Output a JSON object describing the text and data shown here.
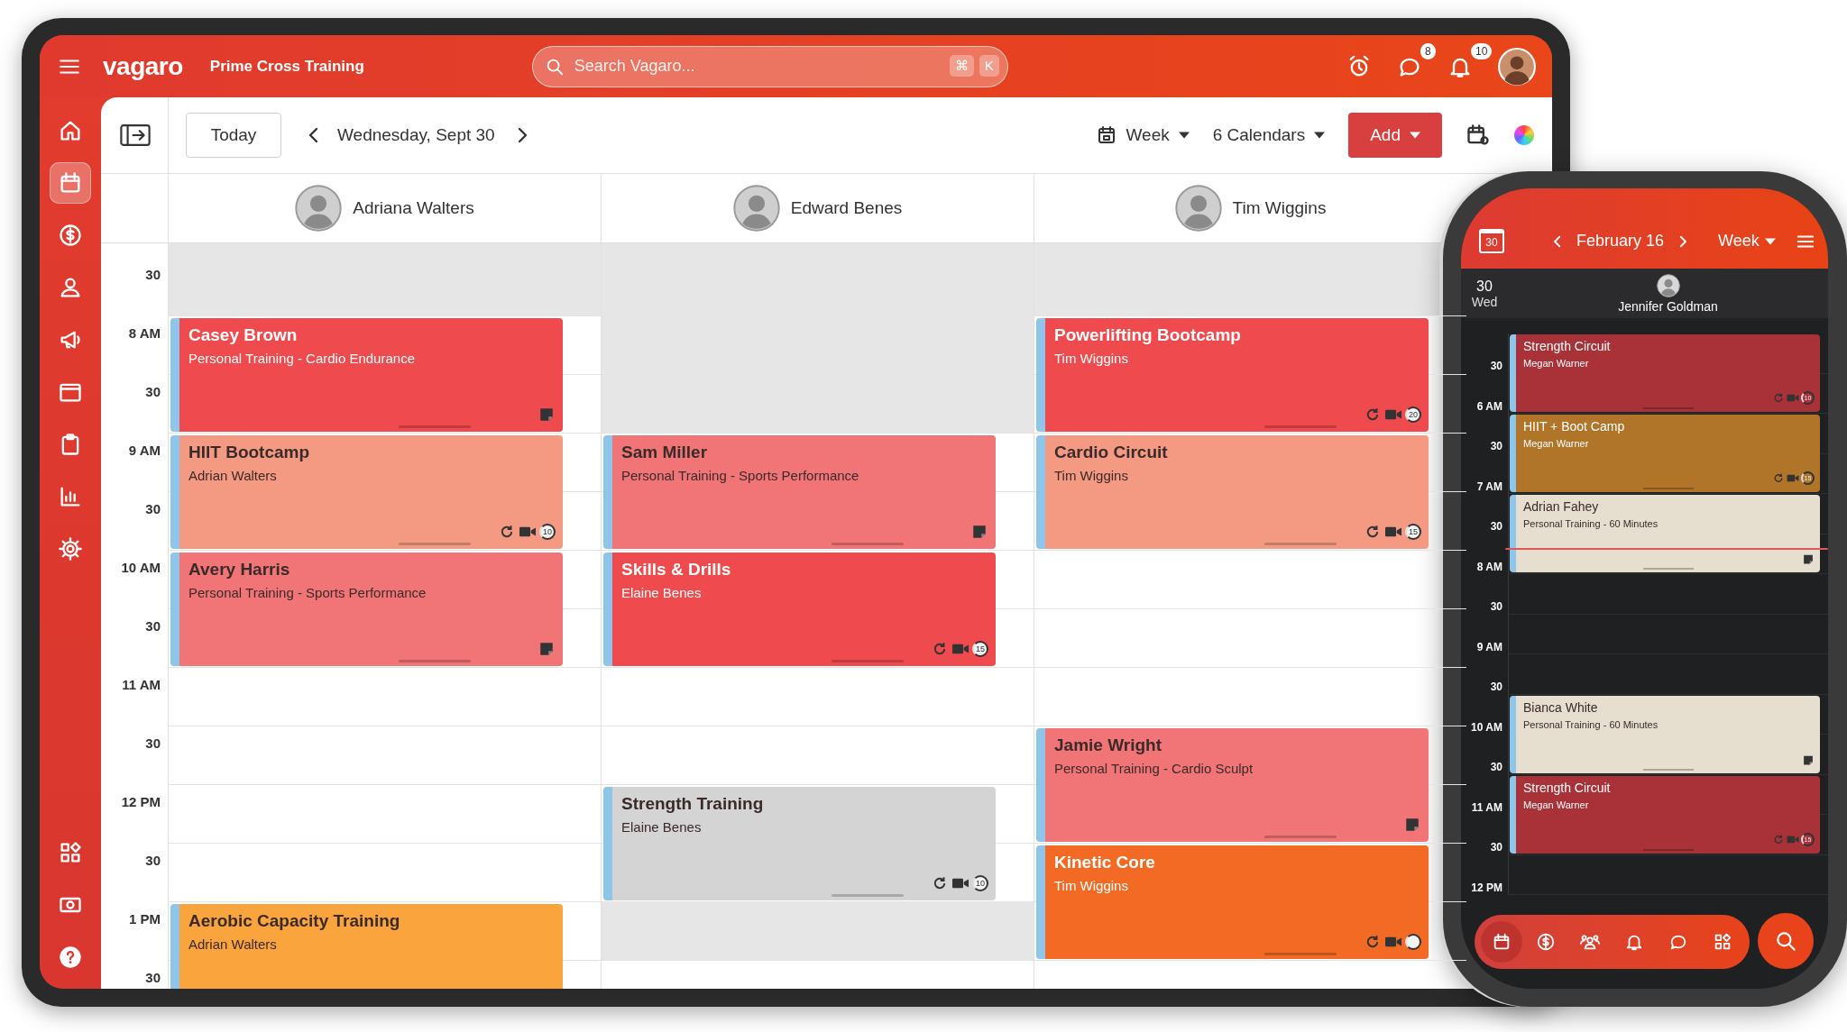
{
  "topbar": {
    "logo": "vagaro",
    "business": "Prime Cross Training",
    "search": {
      "placeholder": "Search Vagaro...",
      "shortcut_keys": [
        "⌘",
        "K"
      ]
    },
    "chat_badge": "8",
    "notification_badge": "10"
  },
  "sidebar": {
    "items": [
      {
        "kind": "home",
        "selected": false
      },
      {
        "kind": "calendar",
        "selected": true
      },
      {
        "kind": "dollar",
        "selected": false
      },
      {
        "kind": "person",
        "selected": false
      },
      {
        "kind": "megaphone",
        "selected": false
      },
      {
        "kind": "window",
        "selected": false
      },
      {
        "kind": "clipboard",
        "selected": false
      },
      {
        "kind": "chart",
        "selected": false
      },
      {
        "kind": "gear",
        "selected": false
      }
    ],
    "bottom_items": [
      {
        "kind": "apps",
        "selected": false
      },
      {
        "kind": "cash",
        "selected": false
      },
      {
        "kind": "help",
        "selected": false
      }
    ]
  },
  "toolbar": {
    "today": "Today",
    "date": "Wednesday, Sept 30",
    "view": "Week",
    "calendars": "6 Calendars",
    "add": "Add"
  },
  "time_labels": [
    "30",
    "8 AM",
    "30",
    "9 AM",
    "30",
    "10 AM",
    "30",
    "11 AM",
    "30",
    "12 PM",
    "30",
    "1 PM",
    "30"
  ],
  "staff": [
    {
      "name": "Adriana Walters",
      "slots": [
        {
          "kind": "unavailable"
        },
        {
          "kind": "appointment",
          "title": "Casey Brown",
          "subtitle": "Personal Training - Cardio Endurance",
          "color": "#ef4a4d"
        },
        {
          "kind": "class",
          "title": "HIIT Bootcamp",
          "subtitle": "Adrian Walters",
          "color": "#f59a82",
          "timer": "10"
        },
        {
          "kind": "appointment",
          "title": "Avery Harris",
          "subtitle": "Personal Training - Sports Performance",
          "color": "#f17577"
        },
        {
          "kind": "free"
        },
        {
          "kind": "free"
        },
        {
          "kind": "free"
        },
        {
          "kind": "free"
        },
        {
          "kind": "class",
          "title": "Aerobic Capacity Training",
          "subtitle": "Adrian Walters",
          "color": "#f9a43c"
        }
      ]
    },
    {
      "name": "Edward Benes",
      "slots": [
        {
          "kind": "unavailable"
        },
        {
          "kind": "unavailable"
        },
        {
          "kind": "unavailable"
        },
        {
          "kind": "appointment",
          "title": "Sam Miller",
          "subtitle": "Personal Training - Sports Performance",
          "color": "#f17577"
        },
        {
          "kind": "class",
          "title": "Skills & Drills",
          "subtitle": "Elaine Benes",
          "color": "#ef4a4d",
          "timer": "15"
        },
        {
          "kind": "free"
        },
        {
          "kind": "free"
        },
        {
          "kind": "class",
          "title": "Strength Training",
          "subtitle": "Elaine Benes",
          "color": "#d4d4d4",
          "timer": "10"
        },
        {
          "kind": "unavailable"
        }
      ]
    },
    {
      "name": "Tim Wiggins",
      "slots": [
        {
          "kind": "unavailable"
        },
        {
          "kind": "class",
          "title": "Powerlifting Bootcamp",
          "subtitle": "Tim Wiggins",
          "color": "#ef4a4d",
          "timer": "20"
        },
        {
          "kind": "class",
          "title": "Cardio Circuit",
          "subtitle": "Tim Wiggins",
          "color": "#f59a82",
          "timer": "15"
        },
        {
          "kind": "free"
        },
        {
          "kind": "free"
        },
        {
          "kind": "free"
        },
        {
          "kind": "appointment",
          "title": "Jamie Wright",
          "subtitle": "Personal Training - Cardio Sculpt",
          "color": "#f17577"
        },
        {
          "kind": "class",
          "title": "Kinetic Core",
          "subtitle": "Tim Wiggins",
          "color": "#f26a24"
        }
      ]
    }
  ],
  "phone": {
    "calendar_day": "30",
    "month_label": "February 16",
    "view": "Week",
    "day_number": "30",
    "weekday": "Wed",
    "staff_name": "Jennifer Goldman",
    "time_labels": [
      "30",
      "6 AM",
      "30",
      "7 AM",
      "30",
      "8 AM",
      "30",
      "9 AM",
      "30",
      "10 AM",
      "30",
      "11 AM",
      "30",
      "12 PM"
    ],
    "slots": [
      {
        "kind": "class",
        "title": "Strength Circuit",
        "subtitle": "Megan Warner",
        "color": "#a83238",
        "timer": "10",
        "current_time_line": false
      },
      {
        "kind": "class",
        "title": "HIIT + Boot Camp",
        "subtitle": "Megan Warner",
        "color": "#b07529",
        "timer": "15",
        "current_time_line": false
      },
      {
        "kind": "appointment",
        "title": "Adrian Fahey",
        "subtitle": "Personal Training - 60 Minutes",
        "color": "#e6dfd0",
        "current_time_line": true
      },
      {
        "kind": "free"
      },
      {
        "kind": "free"
      },
      {
        "kind": "free"
      },
      {
        "kind": "appointment",
        "title": "Bianca White",
        "subtitle": "Personal Training - 60 Minutes",
        "color": "#e6dfd0",
        "current_time_line": false
      },
      {
        "kind": "class",
        "title": "Strength Circuit",
        "subtitle": "Megan Warner",
        "color": "#a83238",
        "timer": "15",
        "current_time_line": false
      }
    ],
    "nav": [
      {
        "kind": "calendar",
        "selected": true
      },
      {
        "kind": "dollar",
        "selected": false
      },
      {
        "kind": "people",
        "selected": false
      },
      {
        "kind": "bell",
        "selected": false
      },
      {
        "kind": "chat",
        "selected": false
      },
      {
        "kind": "apps",
        "selected": false
      }
    ]
  }
}
